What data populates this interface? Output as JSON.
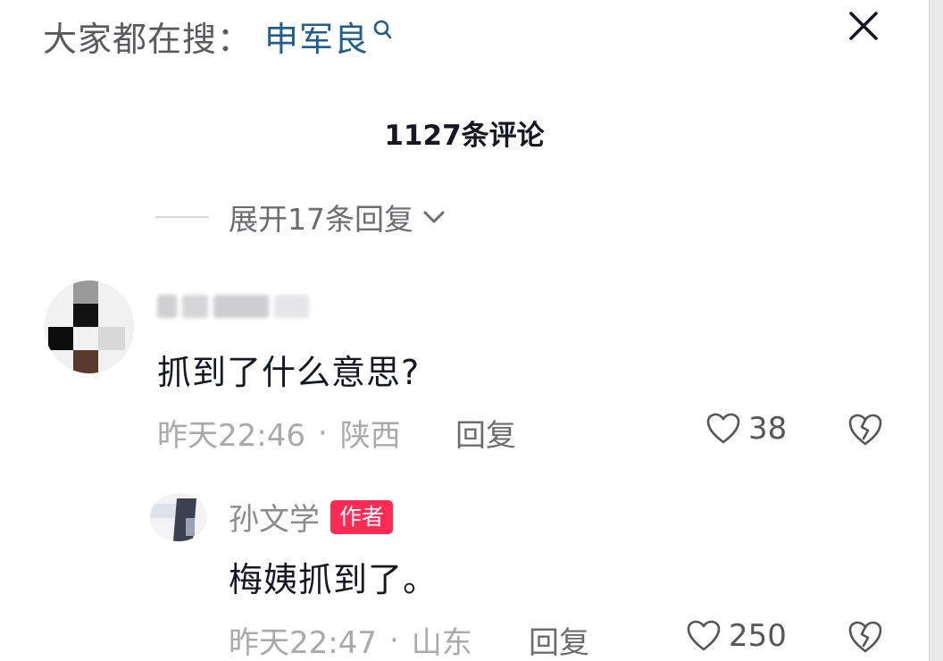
{
  "search_hint": {
    "prefix": "大家都在搜：",
    "term": "申军良",
    "icon": "search-icon"
  },
  "close_icon": "close-icon",
  "comments_header": {
    "count_label": "1127条评论"
  },
  "expand_replies": {
    "label": "展开17条回复",
    "icon": "chevron-down-icon"
  },
  "comments": [
    {
      "username": "",
      "text": "抓到了什么意思?",
      "time": "昨天22:46",
      "location": "陕西",
      "separator": "·",
      "reply_label": "回复",
      "likes": "38",
      "is_author": false
    },
    {
      "username": "孙文学",
      "badge": "作者",
      "text": "梅姨抓到了。",
      "time": "昨天22:47",
      "location": "山东",
      "separator": "·",
      "reply_label": "回复",
      "likes": "250",
      "is_author": true
    }
  ],
  "colors": {
    "link_blue": "#1f5e95",
    "author_badge": "#fe2c55",
    "muted_text": "#a9aaae",
    "primary_text": "#161823"
  }
}
